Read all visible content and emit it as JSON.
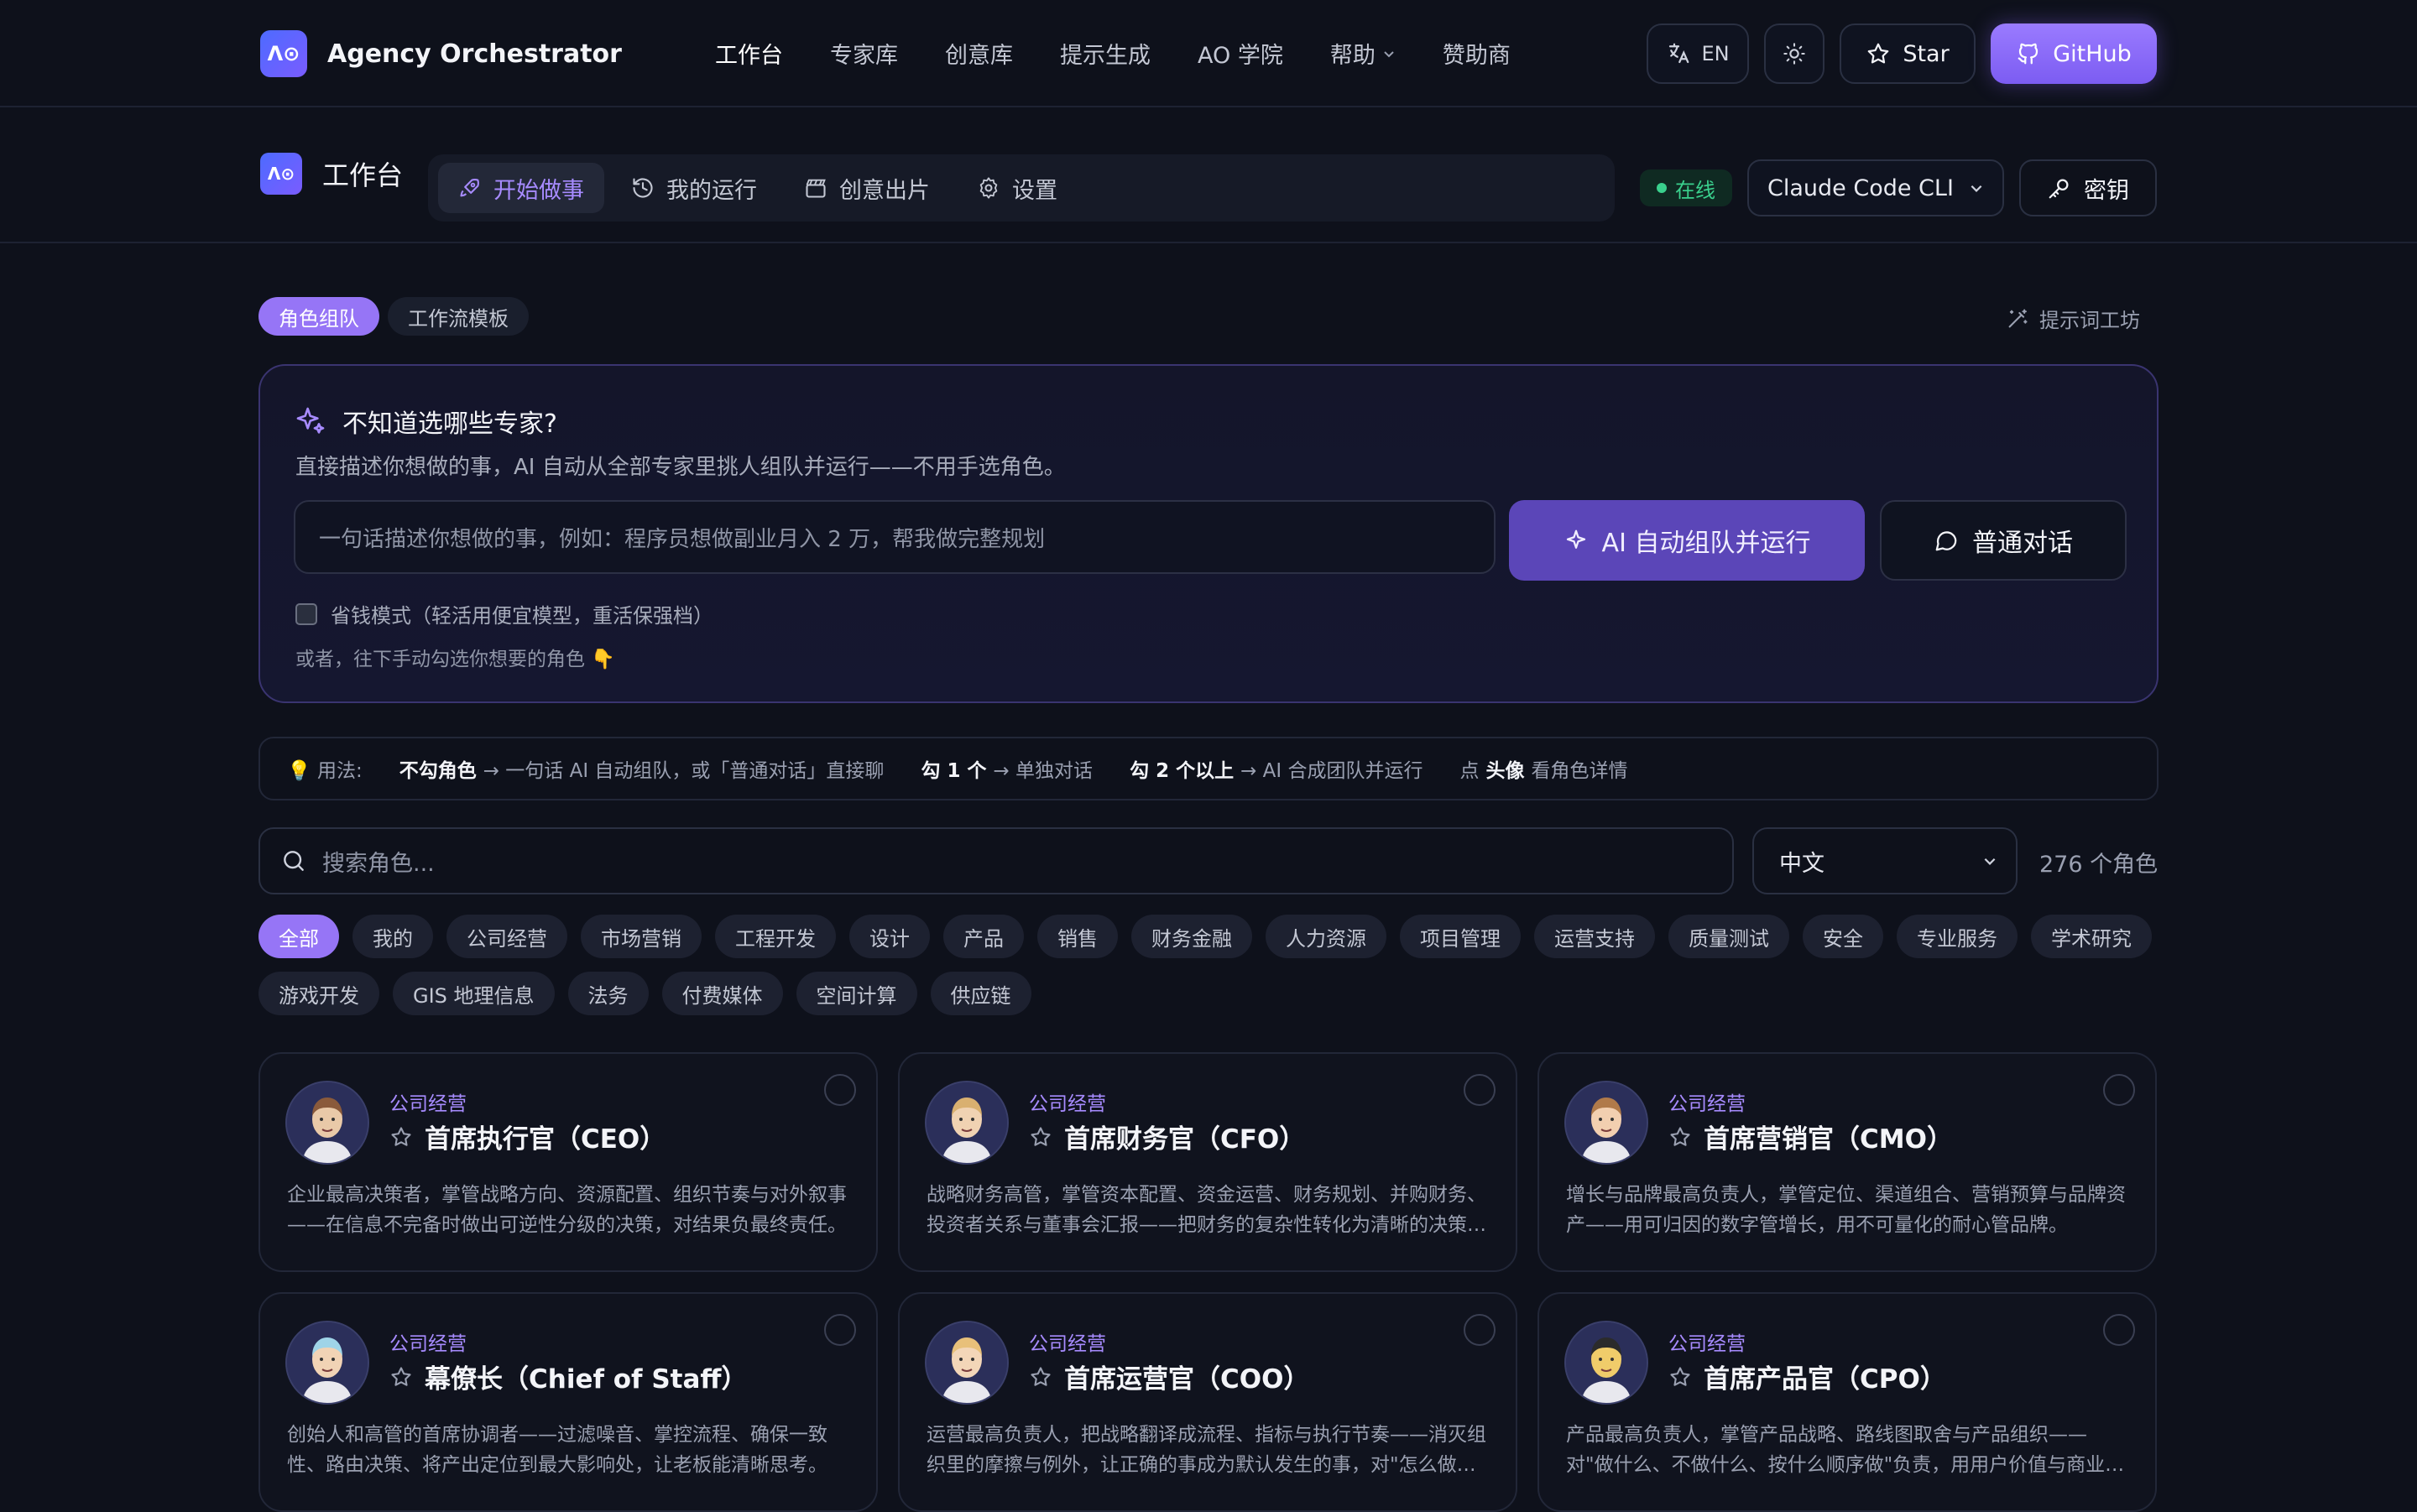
{
  "topnav": {
    "brand": "Agency Orchestrator",
    "logo_text": "Λ⊙",
    "links": [
      "工作台",
      "专家库",
      "创意库",
      "提示生成",
      "AO 学院",
      "帮助",
      "赞助商"
    ],
    "lang": "EN",
    "star": "Star",
    "github": "GitHub"
  },
  "workbench": {
    "title": "工作台",
    "tabs": [
      "开始做事",
      "我的运行",
      "创意出片",
      "设置"
    ],
    "status": "在线",
    "cli": "Claude Code CLI",
    "key": "密钥"
  },
  "mode_tabs": [
    "角色组队",
    "工作流模板"
  ],
  "prompt_workshop": "提示词工坊",
  "ai_panel": {
    "title": "不知道选哪些专家?",
    "desc": "直接描述你想做的事，AI 自动从全部专家里挑人组队并运行——不用手选角色。",
    "placeholder": "一句话描述你想做的事，例如：程序员想做副业月入 2 万，帮我做完整规划",
    "auto_btn": "AI 自动组队并运行",
    "chat_btn": "普通对话",
    "save_mode": "省钱模式（轻活用便宜模型，重活保强档）",
    "hint": "或者，往下手动勾选你想要的角色 👇"
  },
  "usage": {
    "label": "💡 用法:",
    "p1_b": "不勾角色",
    "p1": "→ 一句话 AI 自动组队，或「普通对话」直接聊",
    "p2_b": "勾 1 个",
    "p2": "→ 单独对话",
    "p3_b": "勾 2 个以上",
    "p3": "→ AI 合成团队并运行",
    "p4_a": "点",
    "p4_b": "头像",
    "p4_c": "看角色详情"
  },
  "search": {
    "placeholder": "搜索角色..."
  },
  "language_select": "中文",
  "role_count": "276 个角色",
  "categories": [
    "全部",
    "我的",
    "公司经营",
    "市场营销",
    "工程开发",
    "设计",
    "产品",
    "销售",
    "财务金融",
    "人力资源",
    "项目管理",
    "运营支持",
    "质量测试",
    "安全",
    "专业服务",
    "学术研究",
    "游戏开发",
    "GIS 地理信息",
    "法务",
    "付费媒体",
    "空间计算",
    "供应链"
  ],
  "cards": [
    {
      "category": "公司经营",
      "title": "首席执行官（CEO）",
      "desc": "企业最高决策者，掌管战略方向、资源配置、组织节奏与对外叙事——在信息不完备时做出可逆性分级的决策，对结果负最终责任。"
    },
    {
      "category": "公司经营",
      "title": "首席财务官（CFO）",
      "desc": "战略财务高管，掌管资本配置、资金运营、财务规划、并购财务、投资者关系与董事会汇报——把财务的复杂性转化为清晰的决策依据。"
    },
    {
      "category": "公司经营",
      "title": "首席营销官（CMO）",
      "desc": "增长与品牌最高负责人，掌管定位、渠道组合、营销预算与品牌资产——用可归因的数字管增长，用不可量化的耐心管品牌。"
    },
    {
      "category": "公司经营",
      "title": "幕僚长（Chief of Staff）",
      "desc": "创始人和高管的首席协调者——过滤噪音、掌控流程、确保一致性、路由决策、将产出定位到最大影响处，让老板能清晰思考。"
    },
    {
      "category": "公司经营",
      "title": "首席运营官（COO）",
      "desc": "运营最高负责人，把战略翻译成流程、指标与执行节奏——消灭组织里的摩擦与例外，让正确的事成为默认发生的事，对\"怎么做成\"负责。"
    },
    {
      "category": "公司经营",
      "title": "首席产品官（CPO）",
      "desc": "产品最高负责人，掌管产品战略、路线图取舍与产品组织——对\"做什么、不做什么、按什么顺序做\"负责，用用户价值与商业价值衡量一切。"
    }
  ]
}
